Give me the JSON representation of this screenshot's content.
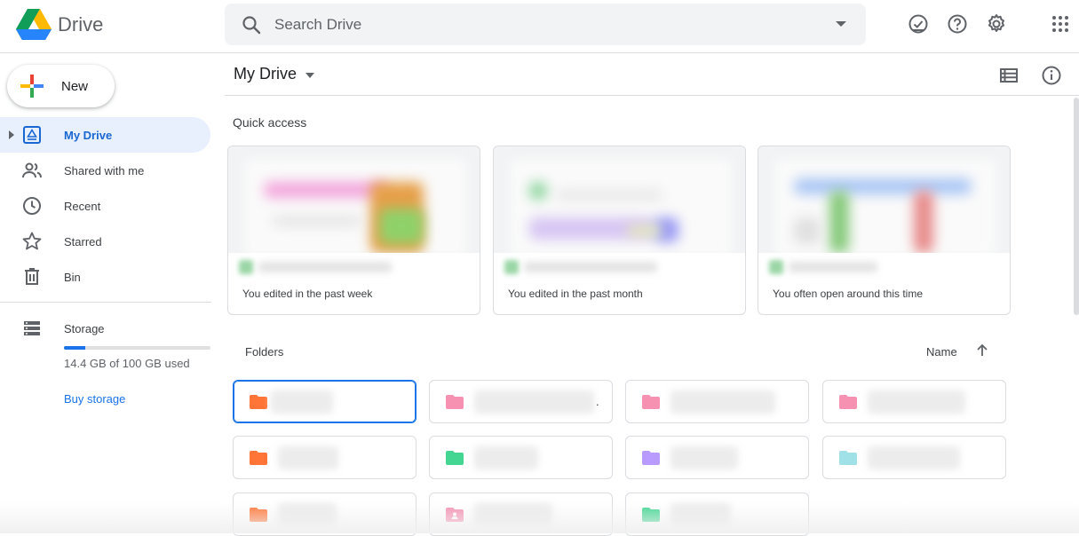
{
  "header": {
    "app_name": "Drive",
    "search_placeholder": "Search Drive"
  },
  "sidebar": {
    "new_label": "New",
    "items": [
      {
        "label": "My Drive",
        "icon": "my-drive-icon"
      },
      {
        "label": "Shared with me",
        "icon": "people-icon"
      },
      {
        "label": "Recent",
        "icon": "clock-icon"
      },
      {
        "label": "Starred",
        "icon": "star-icon"
      },
      {
        "label": "Bin",
        "icon": "trash-icon"
      }
    ],
    "storage": {
      "label": "Storage",
      "used_text": "14.4 GB of 100 GB used",
      "used_fraction": 0.144,
      "buy_label": "Buy storage"
    }
  },
  "main": {
    "title": "My Drive",
    "quick_access_label": "Quick access",
    "quick_access": [
      {
        "reason": "You edited in the past week"
      },
      {
        "reason": "You edited in the past month"
      },
      {
        "reason": "You often open around this time"
      }
    ],
    "folders_label": "Folders",
    "sort_label": "Name",
    "folders": [
      {
        "color": "#ff7537",
        "icon": "folder-icon"
      },
      {
        "color": "#f691b2",
        "icon": "folder-icon"
      },
      {
        "color": "#f691b2",
        "icon": "folder-icon"
      },
      {
        "color": "#f691b2",
        "icon": "folder-icon"
      },
      {
        "color": "#ff7537",
        "icon": "folder-icon"
      },
      {
        "color": "#42d692",
        "icon": "folder-icon"
      },
      {
        "color": "#b99aff",
        "icon": "folder-icon"
      },
      {
        "color": "#9fe1e7",
        "icon": "folder-icon"
      },
      {
        "color": "#ff7537",
        "icon": "folder-icon"
      },
      {
        "color": "#f691b2",
        "icon": "shared-folder-icon"
      },
      {
        "color": "#42d692",
        "icon": "folder-icon"
      }
    ],
    "folder_truncation": "."
  },
  "colors": {
    "accent": "#1a73e8",
    "active_nav_bg": "#e8f0fe"
  }
}
